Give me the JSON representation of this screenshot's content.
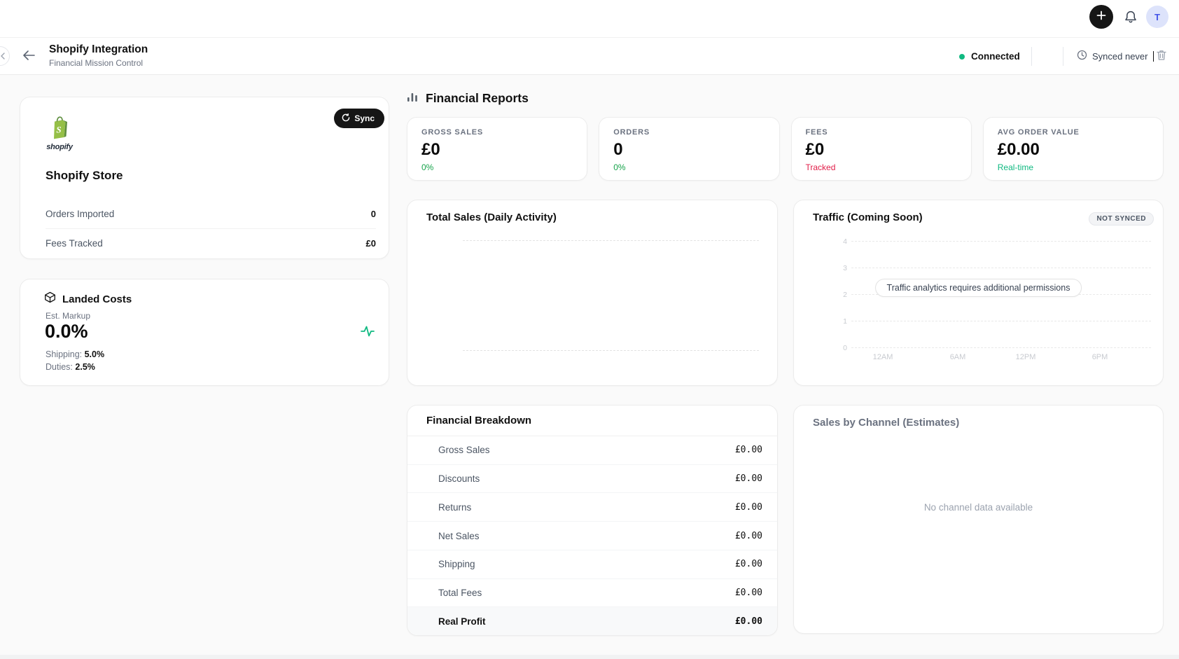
{
  "topbar": {
    "avatar_initial": "T"
  },
  "header": {
    "title": "Shopify Integration",
    "subtitle": "Financial Mission Control",
    "status_label": "Connected",
    "synced_label": "Synced never"
  },
  "store_card": {
    "brand_word": "shopify",
    "brand_letter": "S",
    "sync_label": "Sync",
    "title": "Shopify Store",
    "rows": [
      {
        "label": "Orders Imported",
        "value": "0"
      },
      {
        "label": "Fees Tracked",
        "value": "£0"
      }
    ]
  },
  "landed_costs": {
    "title": "Landed Costs",
    "metric_label": "Est. Markup",
    "metric_value": "0.0%",
    "details": [
      {
        "label": "Shipping:",
        "value": "5.0%"
      },
      {
        "label": "Duties:",
        "value": "2.5%"
      }
    ]
  },
  "reports": {
    "section_title": "Financial Reports",
    "stats": [
      {
        "label": "GROSS SALES",
        "value": "£0",
        "sub": "0%",
        "sub_color": "#16a34a"
      },
      {
        "label": "ORDERS",
        "value": "0",
        "sub": "0%",
        "sub_color": "#16a34a"
      },
      {
        "label": "FEES",
        "value": "£0",
        "sub": "Tracked",
        "sub_color": "#e11d48"
      },
      {
        "label": "AVG ORDER VALUE",
        "value": "£0.00",
        "sub": "Real-time",
        "sub_color": "#10b981"
      }
    ]
  },
  "total_sales": {
    "title": "Total Sales (Daily Activity)"
  },
  "traffic": {
    "title": "Traffic (Coming Soon)",
    "badge": "NOT SYNCED",
    "message": "Traffic analytics requires additional permissions",
    "y_ticks": [
      "4",
      "3",
      "2",
      "1",
      "0"
    ],
    "x_ticks": [
      "12AM",
      "6AM",
      "12PM",
      "6PM"
    ]
  },
  "breakdown": {
    "title": "Financial Breakdown",
    "rows": [
      {
        "label": "Gross Sales",
        "value": "£0.00"
      },
      {
        "label": "Discounts",
        "value": "£0.00"
      },
      {
        "label": "Returns",
        "value": "£0.00"
      },
      {
        "label": "Net Sales",
        "value": "£0.00"
      },
      {
        "label": "Shipping",
        "value": "£0.00"
      },
      {
        "label": "Total Fees",
        "value": "£0.00"
      },
      {
        "label": "Real Profit",
        "value": "£0.00"
      }
    ]
  },
  "channels": {
    "title": "Sales by Channel (Estimates)",
    "empty_message": "No channel data available"
  },
  "icons": {
    "sidebar_collapse": "chevron-left",
    "back": "arrow-left",
    "create": "plus",
    "notifications": "bell",
    "sync_status": "clock",
    "delete": "trash",
    "sync_button": "refresh",
    "reports_section": "bar-chart",
    "landed_costs": "package",
    "markup_trend": "activity",
    "brand": "shopify-bag"
  },
  "colors": {
    "connected_dot": "#10b981",
    "positive": "#16a34a",
    "fees_tracked": "#e11d48",
    "realtime": "#10b981",
    "shopify_green": "#95BF47",
    "avatar_bg": "#dde3fb",
    "avatar_text": "#4353e8",
    "button_black": "#161616"
  }
}
